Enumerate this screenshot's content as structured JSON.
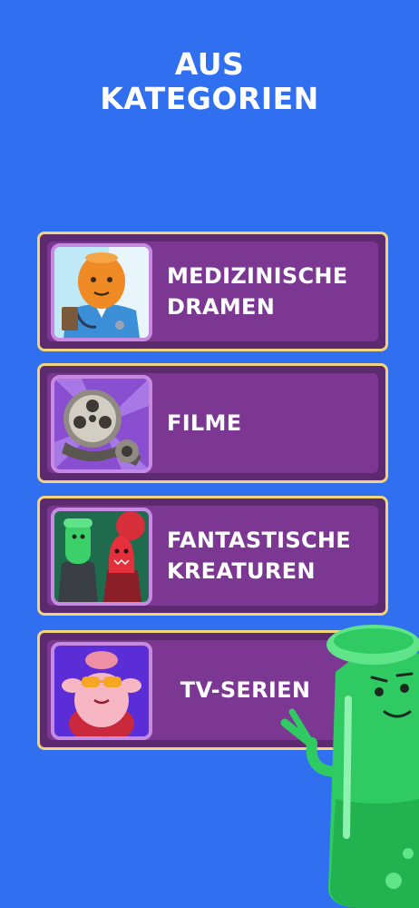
{
  "header": {
    "line1": "AUS",
    "line2": "KATEGORIEN"
  },
  "categories": [
    {
      "label": "MEDIZINISCHE DRAMEN",
      "icon": "doctor-character-icon"
    },
    {
      "label": "FILME",
      "icon": "film-reel-icon"
    },
    {
      "label": "FANTASTISCHE KREATUREN",
      "icon": "creatures-icon"
    },
    {
      "label": "TV-SERIEN",
      "icon": "turkey-sunglasses-icon"
    }
  ],
  "colors": {
    "background": "#2f6ff0",
    "card_border": "#f2d37e",
    "card_fill": "#7b3792",
    "thumb_border": "#c68be0",
    "mascot": "#2fcb62"
  }
}
